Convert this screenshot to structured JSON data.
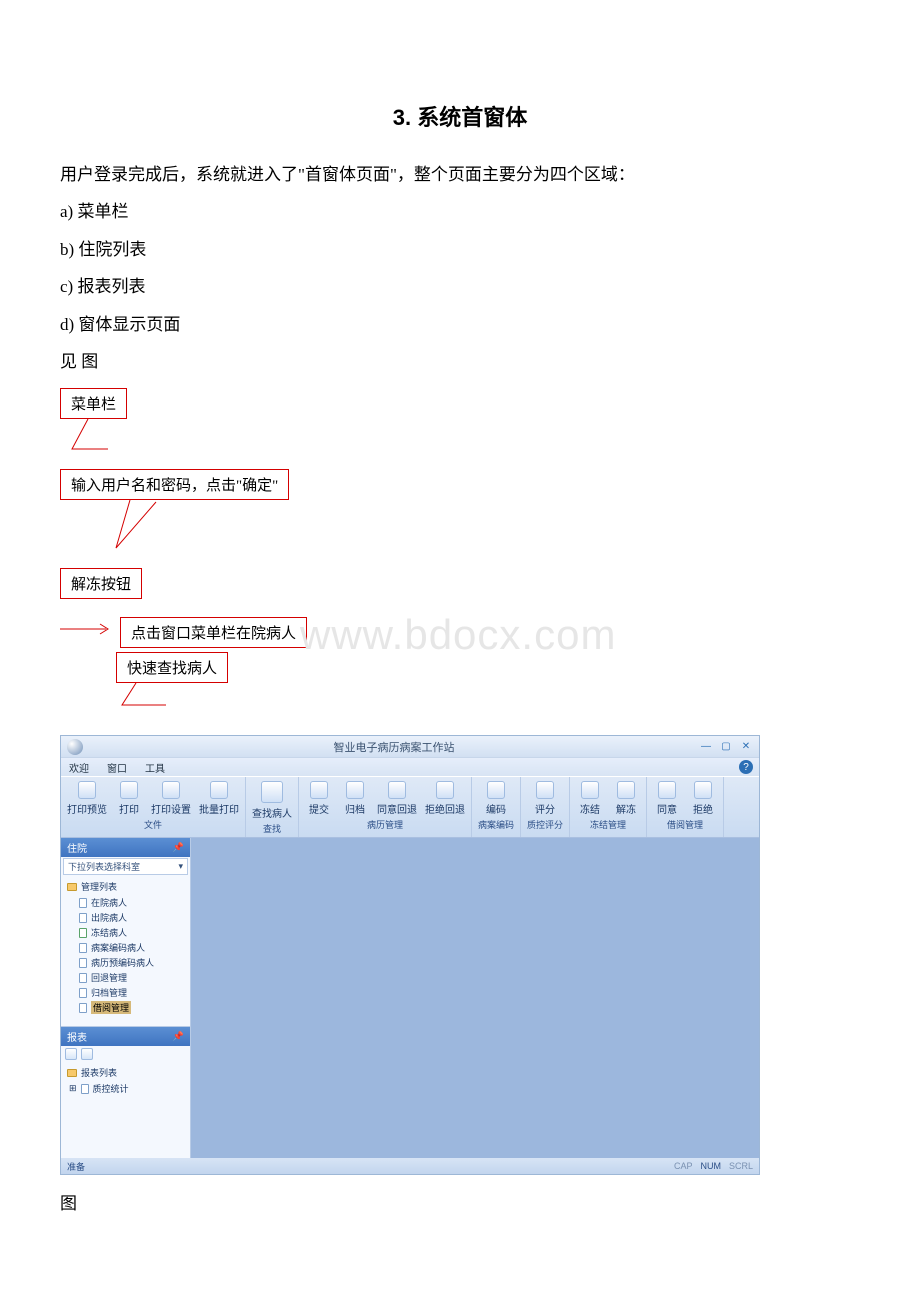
{
  "heading": "3. 系统首窗体",
  "intro": "用户登录完成后，系统就进入了\"首窗体页面\"，整个页面主要分为四个区域：",
  "list": {
    "a": "a) 菜单栏",
    "b": "b) 住院列表",
    "c": "c) 报表列表",
    "d": "d) 窗体显示页面"
  },
  "see_fig": "见 图",
  "callouts": {
    "menubar": "菜单栏",
    "login": "输入用户名和密码，点击\"确定\"",
    "unfreeze": "解冻按钮",
    "click_inpatient": "点击窗口菜单栏在院病人",
    "quick_find": "快速查找病人"
  },
  "watermark": "www.bdocx.com",
  "fig_label": "图",
  "app": {
    "title": "智业电子病历病案工作站",
    "menus": {
      "welcome": "欢迎",
      "window": "窗口",
      "tools": "工具"
    },
    "ribbon": {
      "file": {
        "label": "文件",
        "btns": [
          "打印预览",
          "打印",
          "打印设置",
          "批量打印"
        ]
      },
      "find": {
        "label": "查找",
        "btns": [
          "查找病人"
        ]
      },
      "manage": {
        "label": "病历管理",
        "btns": [
          "提交",
          "归档",
          "同意回退",
          "拒绝回退"
        ]
      },
      "code": {
        "label": "病案编码",
        "btns": [
          "编码"
        ]
      },
      "qc": {
        "label": "质控评分",
        "btns": [
          "评分"
        ]
      },
      "freeze": {
        "label": "冻结管理",
        "btns": [
          "冻结",
          "解冻"
        ]
      },
      "borrow": {
        "label": "借阅管理",
        "btns": [
          "同意",
          "拒绝"
        ]
      }
    },
    "left": {
      "inpatient_head": "住院",
      "dept_label": "下拉列表选择科室",
      "root": "管理列表",
      "items": [
        "在院病人",
        "出院病人",
        "冻结病人",
        "病案编码病人",
        "病历预编码病人",
        "回退管理",
        "归档管理",
        "借阅管理"
      ],
      "report_head": "报表",
      "report_root": "报表列表",
      "report_item": "质控统计"
    },
    "status": {
      "ready": "准备",
      "cap": "CAP",
      "num": "NUM",
      "scrl": "SCRL"
    }
  }
}
